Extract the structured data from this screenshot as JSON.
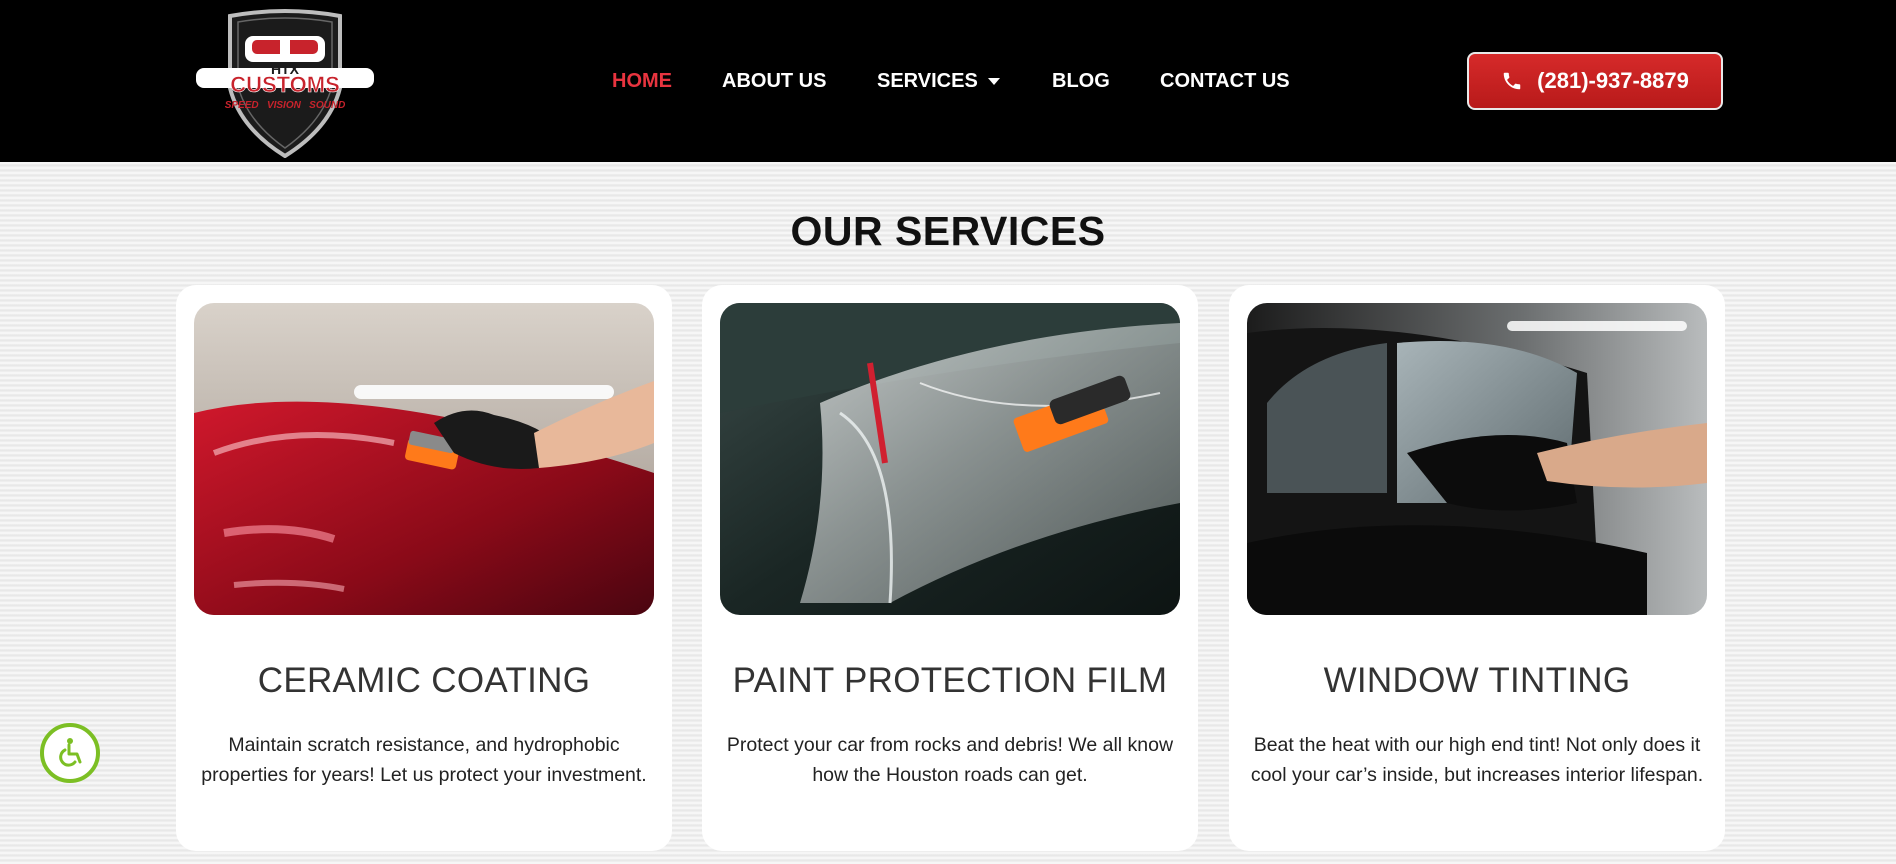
{
  "logo": {
    "top_text": "HTX",
    "main_text": "CUSTOMS",
    "tagline": "SPEED   VISION   SOUND"
  },
  "nav": {
    "items": [
      {
        "label": "HOME",
        "active": true
      },
      {
        "label": "ABOUT US"
      },
      {
        "label": "SERVICES",
        "has_dropdown": true
      },
      {
        "label": "BLOG"
      },
      {
        "label": "CONTACT US"
      }
    ]
  },
  "phone": {
    "label": "(281)-937-8879",
    "icon": "phone-icon"
  },
  "section": {
    "title": "OUR SERVICES"
  },
  "services": [
    {
      "title": "CERAMIC COATING",
      "desc_line1": "Maintain scratch resistance, and hydrophobic",
      "desc_line2": "properties for years! Let us protect your investment."
    },
    {
      "title": "PAINT PROTECTION FILM",
      "desc_line1": "Protect your car from rocks and debris! We all know",
      "desc_line2": "how the Houston roads can get."
    },
    {
      "title": "WINDOW TINTING",
      "desc_line1": "Beat the heat with our high end tint! Not only does it",
      "desc_line2": "cool your car’s inside, but increases interior lifespan."
    }
  ],
  "colors": {
    "accent": "#e8343f",
    "button": "#c62121",
    "accessibility": "#7cbf24",
    "header_bg": "#000000"
  }
}
